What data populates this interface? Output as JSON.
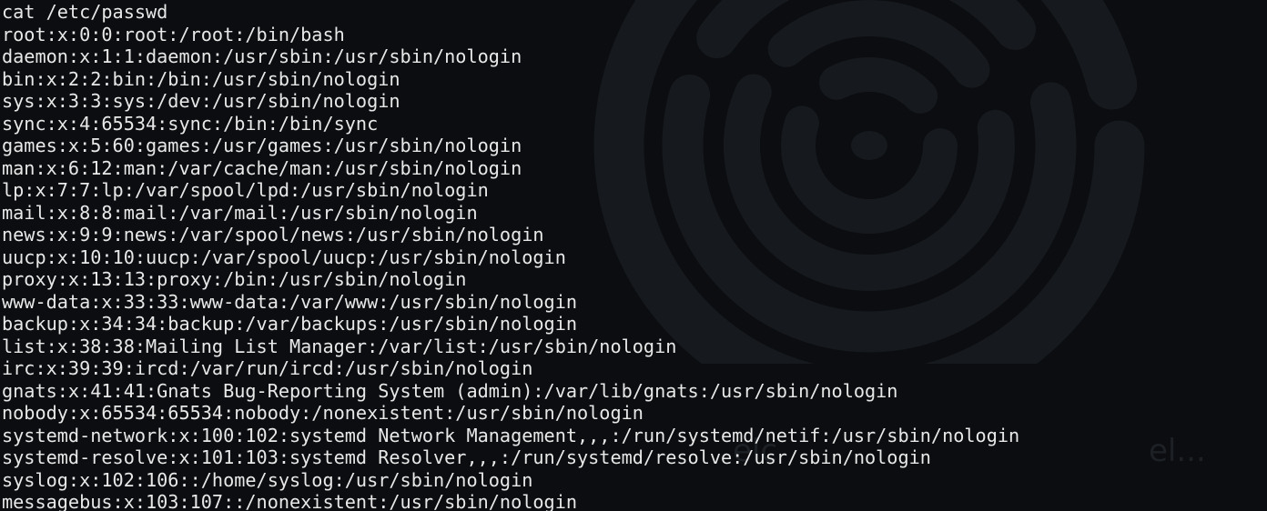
{
  "terminal": {
    "command": "cat /etc/passwd",
    "lines": [
      "root:x:0:0:root:/root:/bin/bash",
      "daemon:x:1:1:daemon:/usr/sbin:/usr/sbin/nologin",
      "bin:x:2:2:bin:/bin:/usr/sbin/nologin",
      "sys:x:3:3:sys:/dev:/usr/sbin/nologin",
      "sync:x:4:65534:sync:/bin:/bin/sync",
      "games:x:5:60:games:/usr/games:/usr/sbin/nologin",
      "man:x:6:12:man:/var/cache/man:/usr/sbin/nologin",
      "lp:x:7:7:lp:/var/spool/lpd:/usr/sbin/nologin",
      "mail:x:8:8:mail:/var/mail:/usr/sbin/nologin",
      "news:x:9:9:news:/var/spool/news:/usr/sbin/nologin",
      "uucp:x:10:10:uucp:/var/spool/uucp:/usr/sbin/nologin",
      "proxy:x:13:13:proxy:/bin:/usr/sbin/nologin",
      "www-data:x:33:33:www-data:/var/www:/usr/sbin/nologin",
      "backup:x:34:34:backup:/var/backups:/usr/sbin/nologin",
      "list:x:38:38:Mailing List Manager:/var/list:/usr/sbin/nologin",
      "irc:x:39:39:ircd:/var/run/ircd:/usr/sbin/nologin",
      "gnats:x:41:41:Gnats Bug-Reporting System (admin):/var/lib/gnats:/usr/sbin/nologin",
      "nobody:x:65534:65534:nobody:/nonexistent:/usr/sbin/nologin",
      "systemd-network:x:100:102:systemd Network Management,,,:/run/systemd/netif:/usr/sbin/nologin",
      "systemd-resolve:x:101:103:systemd Resolver,,,:/run/systemd/resolve:/usr/sbin/nologin",
      "syslog:x:102:106::/home/syslog:/usr/sbin/nologin",
      "messagebus:x:103:107::/nonexistent:/usr/sbin/nologin"
    ]
  },
  "background": {
    "ghost_left": "elc",
    "ghost_right": "el..."
  },
  "colors": {
    "text": "#e8e8e8",
    "background": "#0b0d10",
    "watermark": "#16191d"
  },
  "icons": {
    "watermark": "maze-icon"
  }
}
